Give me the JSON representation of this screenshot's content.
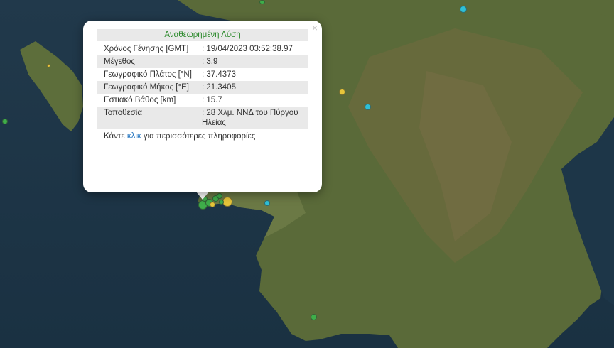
{
  "popup": {
    "title": "Αναθεωρημένη Λύση",
    "close_icon": "×",
    "rows": [
      {
        "label": "Χρόνος Γένησης [GMT]",
        "value": ": 19/04/2023 03:52:38.97"
      },
      {
        "label": "Μέγεθος",
        "value": ": 3.9"
      },
      {
        "label": "Γεωγραφικό Πλάτος [°N]",
        "value": ": 37.4373"
      },
      {
        "label": "Γεωγραφικό Μήκος [°E]",
        "value": ": 21.3405"
      },
      {
        "label": "Εστιακό Βάθος [km]",
        "value": ": 15.7"
      },
      {
        "label": "Τοποθεσία",
        "value": ": 28 Χλμ. ΝΝΔ του Πύργου Ηλείας"
      }
    ],
    "footer": {
      "prefix": "Κάντε",
      "link": "κλικ",
      "suffix": "για περισσότερες πληροφορίες"
    }
  },
  "map": {
    "sea_color": "#1b3447",
    "land_color": "#5c6b3a",
    "marker_colors": {
      "green": "#3fae4a",
      "yellow": "#e6c53a",
      "cyan": "#2fc0d6"
    },
    "markers": [
      {
        "color": "green"
      },
      {
        "color": "green"
      },
      {
        "color": "green"
      },
      {
        "color": "yellow"
      },
      {
        "color": "yellow"
      },
      {
        "color": "green"
      },
      {
        "color": "green"
      },
      {
        "color": "green"
      },
      {
        "color": "cyan"
      },
      {
        "color": "cyan"
      },
      {
        "color": "cyan"
      },
      {
        "color": "yellow"
      },
      {
        "color": "green"
      },
      {
        "color": "green"
      },
      {
        "color": "yellow"
      },
      {
        "color": "green"
      }
    ]
  }
}
